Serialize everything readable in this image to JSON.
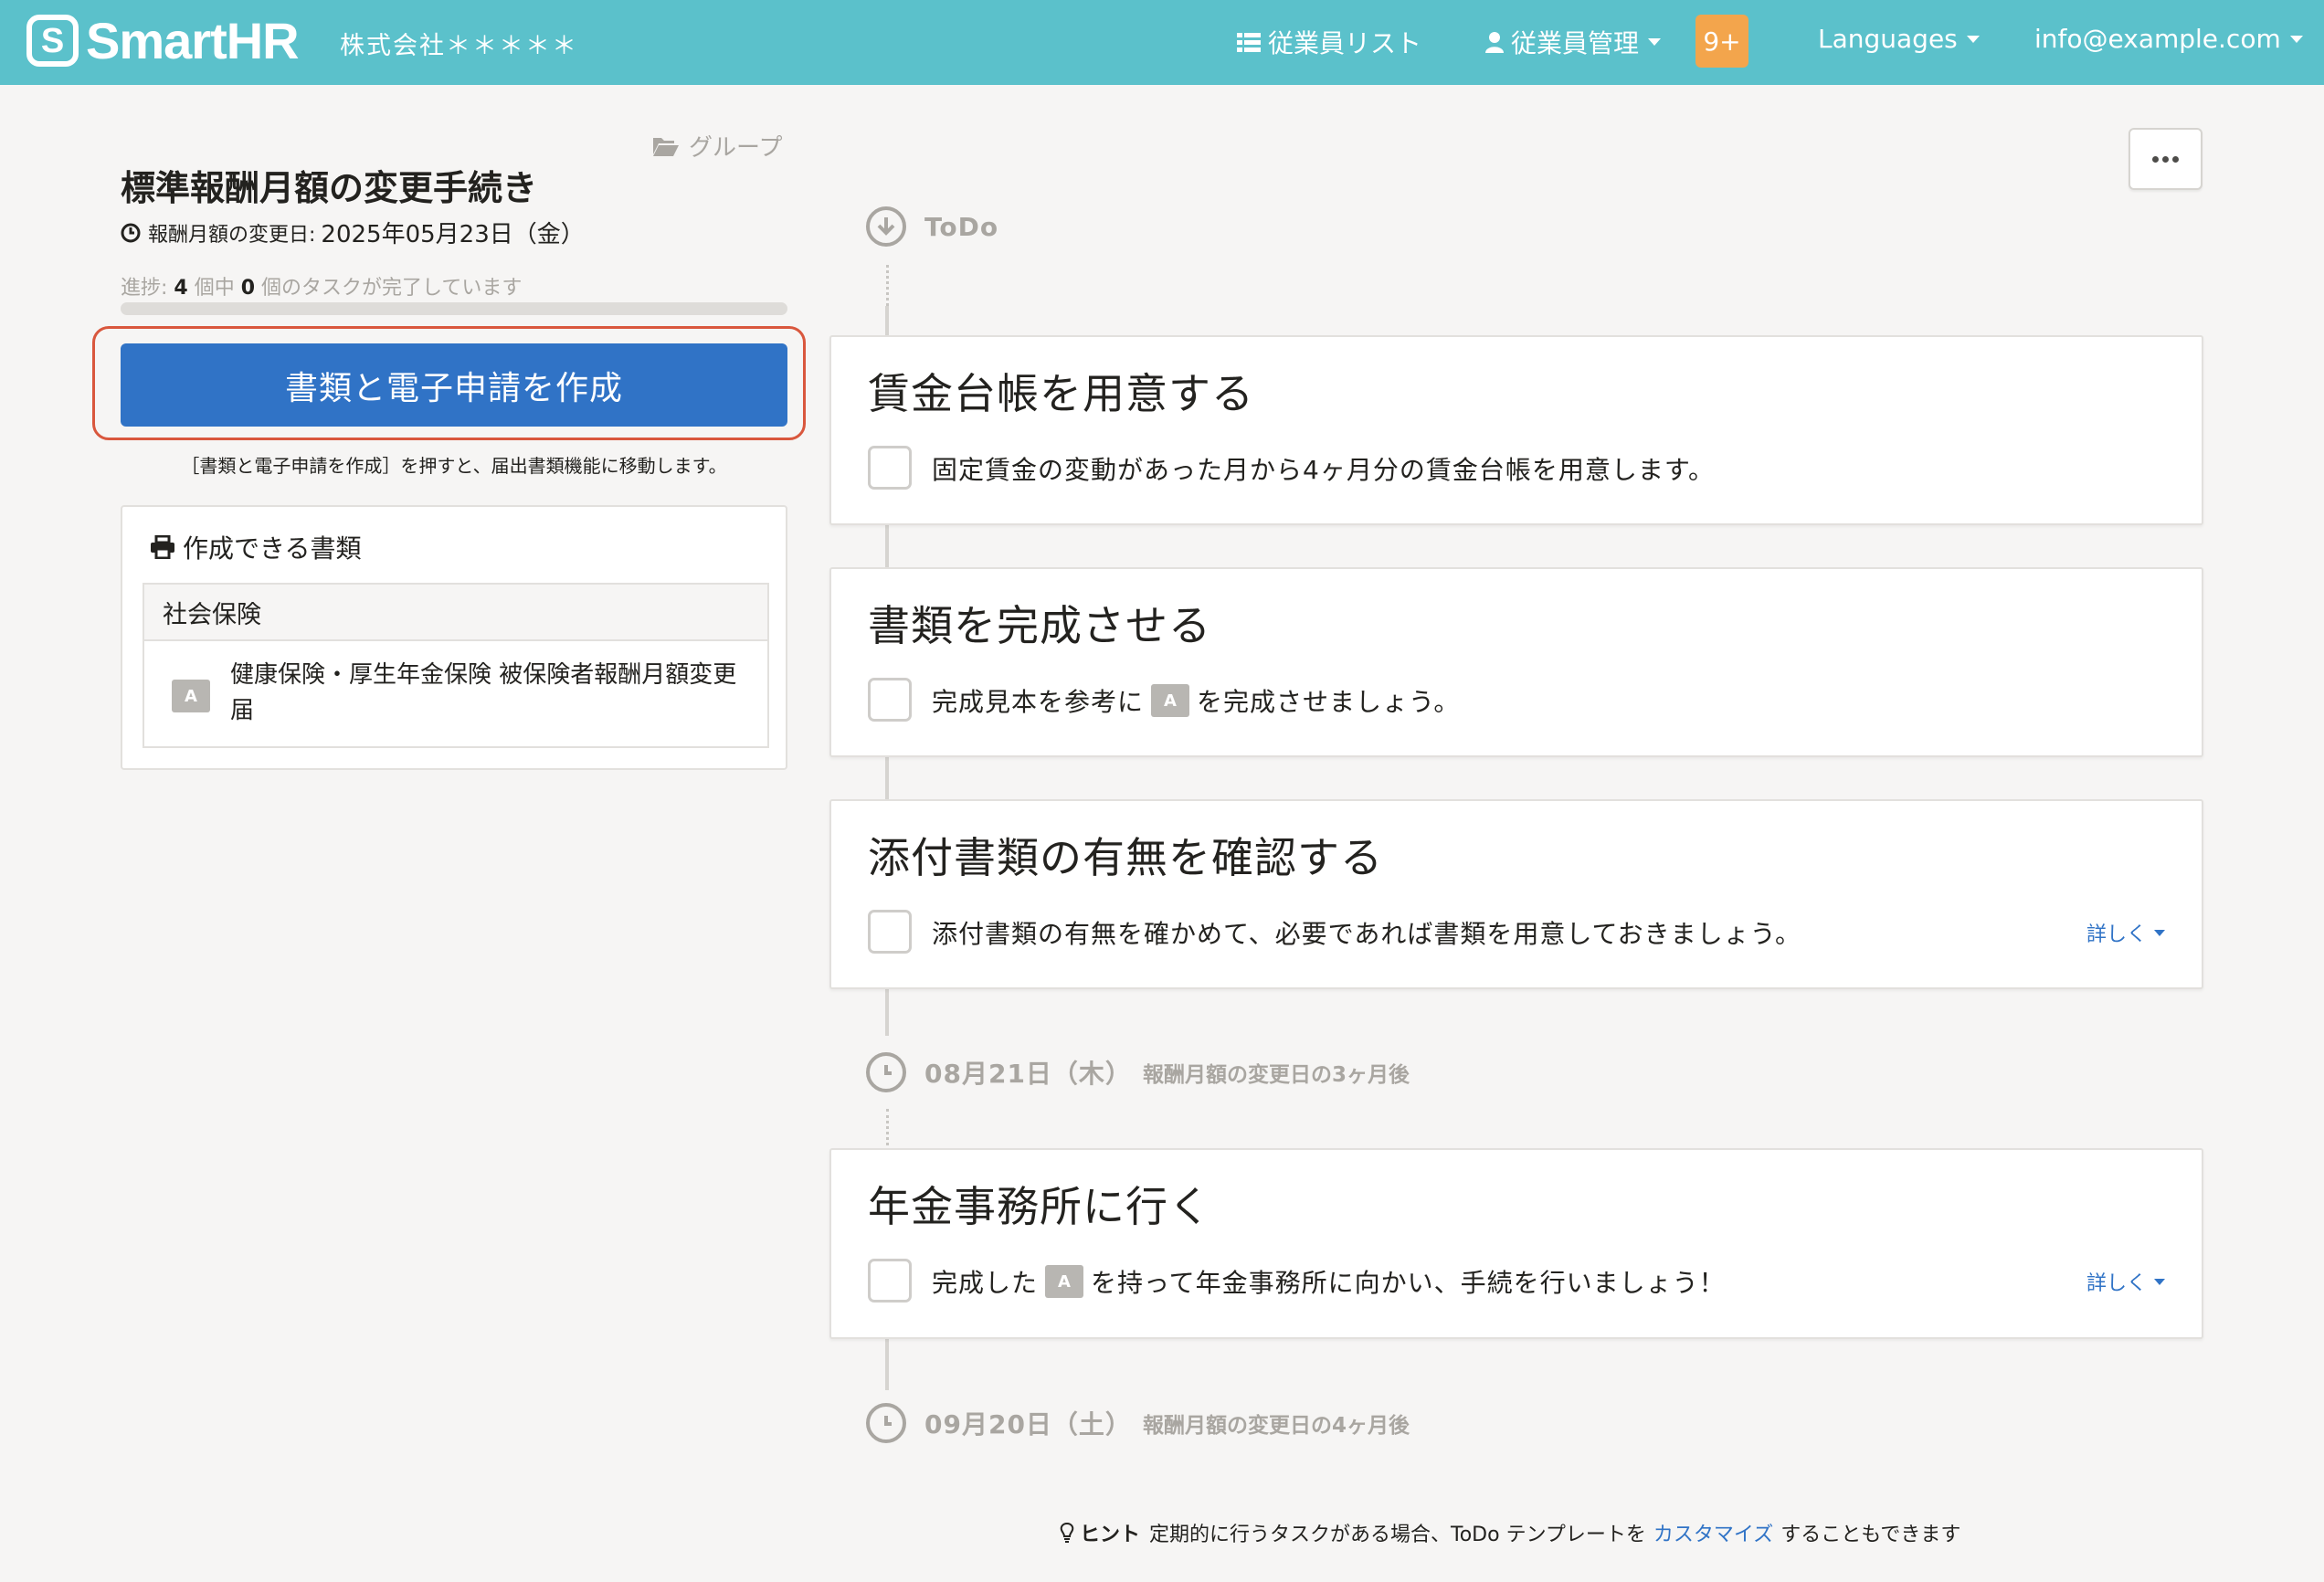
{
  "header": {
    "brand": "SmartHR",
    "brand_mark": "S",
    "company": "株式会社＊＊＊＊＊",
    "nav_employee_list": "従業員リスト",
    "nav_employee_manage": "従業員管理",
    "notifications_badge": "9+",
    "nav_languages": "Languages",
    "nav_account": "info@example.com",
    "color": "#5bc1cb"
  },
  "left": {
    "group_link": "グループ",
    "title": "標準報酬月額の変更手続き",
    "change_date_label": "報酬月額の変更日:",
    "change_date_value": "2025年05月23日（金）",
    "progress_prefix": "進捗: ",
    "progress_total": "4",
    "progress_mid": " 個中 ",
    "progress_done": "0",
    "progress_suffix": " 個のタスクが完了しています",
    "progress_fraction": 0,
    "create_button": "書類と電子申請を作成",
    "create_note": "［書類と電子申請を作成］を押すと、届出書類機能に移動します。",
    "docs_heading": "作成できる書類",
    "docs_group": "社会保険",
    "doc_badge": "A",
    "doc_name": "健康保険・厚生年金保険 被保険者報酬月額変更届"
  },
  "timeline": {
    "todo_label": "ToDo",
    "date1_main": "08月21日（木）",
    "date1_sub": "報酬月額の変更日の3ヶ月後",
    "date2_main": "09月20日（土）",
    "date2_sub": "報酬月額の変更日の4ヶ月後",
    "tasks": [
      {
        "title": "賃金台帳を用意する",
        "desc": "固定賃金の変動があった月から4ヶ月分の賃金台帳を用意します。"
      },
      {
        "title": "書類を完成させる",
        "desc_before": "完成見本を参考に",
        "chip": "A",
        "desc_after": "を完成させましょう。"
      },
      {
        "title": "添付書類の有無を確認する",
        "desc": "添付書類の有無を確かめて、必要であれば書類を用意しておきましょう。",
        "details": "詳しく"
      },
      {
        "title": "年金事務所に行く",
        "desc_before": "完成した",
        "chip": "A",
        "desc_after": "を持って年金事務所に向かい、手続を行いましょう！",
        "details": "詳しく"
      }
    ]
  },
  "hint": {
    "label": "ヒント",
    "text_before": "定期的に行うタスクがある場合、ToDo テンプレートを",
    "link": "カスタマイズ",
    "text_after": "することもできます"
  },
  "colors": {
    "primary": "#3073c6",
    "highlight": "#d9573d",
    "badge": "#f3a54c"
  }
}
